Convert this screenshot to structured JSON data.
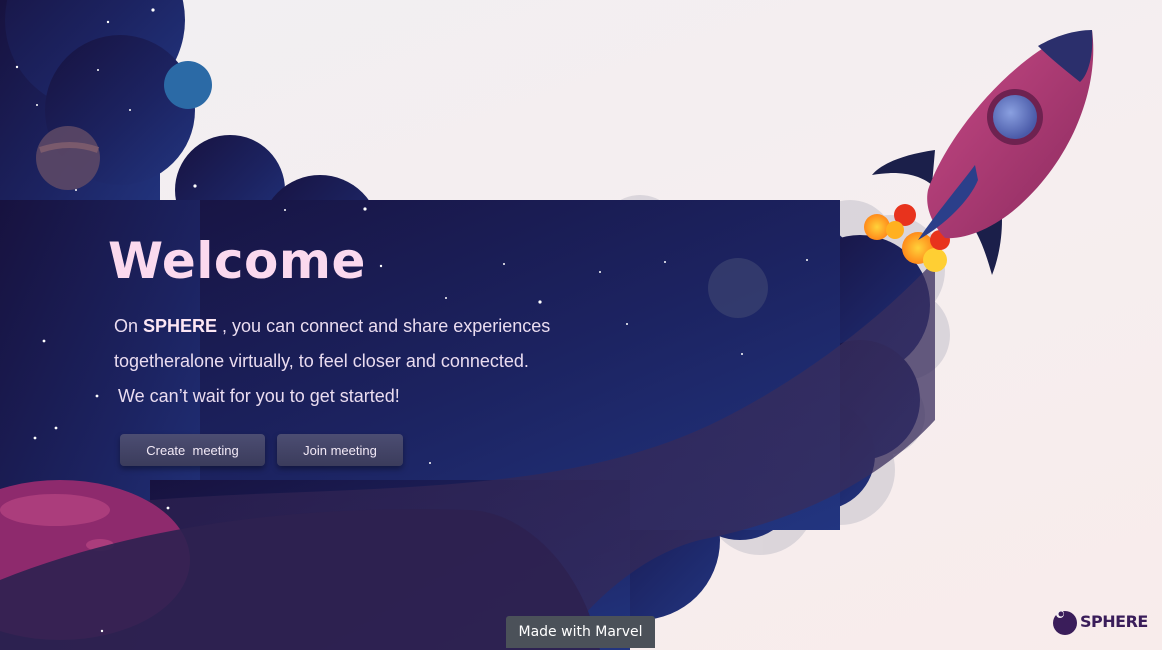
{
  "hero": {
    "title": "Welcome",
    "line1_prefix": "On ",
    "brand": "SPHERE",
    "line1_suffix": " , you can connect and share experiences",
    "line2": "togetheralone virtually, to feel closer and connected.",
    "line3": "We can’t wait for you to get started!"
  },
  "actions": {
    "create_label": "Create  meeting",
    "join_label": "Join meeting"
  },
  "footer": {
    "marvel_label": "Made with Marvel",
    "logo_text": "SPHERE"
  },
  "colors": {
    "space_dark": "#1a1440",
    "space_blue": "#1f2a66",
    "planet_pink": "#8e2a6d",
    "rocket_body": "#b63d78",
    "title_pink": "#fbd9ee",
    "button_bg": "#45466a",
    "logo_purple": "#3a1d5a"
  },
  "icons": [
    "rocket-icon",
    "planet-icon",
    "moon-icon",
    "star-icon",
    "sphere-logo-icon"
  ]
}
